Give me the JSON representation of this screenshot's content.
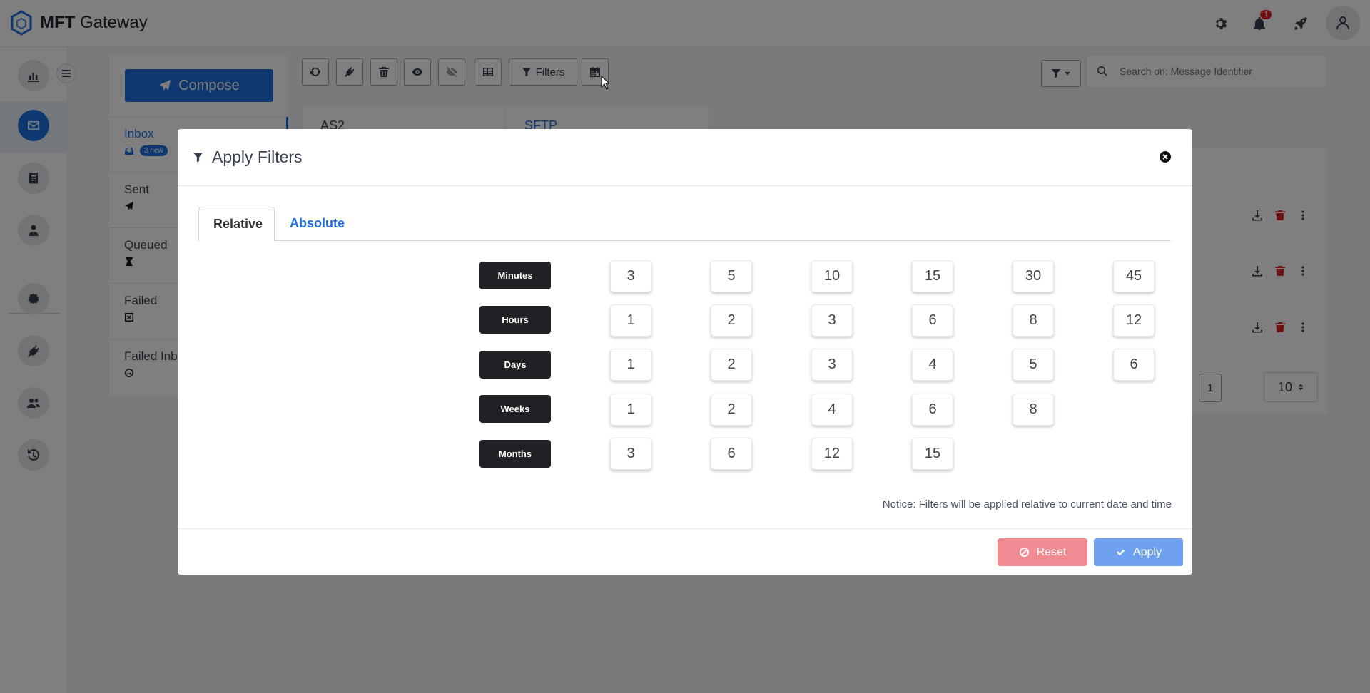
{
  "app": {
    "brand_bold": "MFT",
    "brand_rest": " Gateway",
    "notification_count": "1",
    "accent_color": "#1d6fe0"
  },
  "sidebar": {
    "items": [
      {
        "icon": "chart-icon"
      },
      {
        "icon": "envelope-icon",
        "active": true
      },
      {
        "icon": "receipt-icon"
      },
      {
        "icon": "user-tie-icon"
      },
      {
        "icon": "gear-burst-icon"
      },
      {
        "icon": "plug-icon"
      },
      {
        "icon": "users-icon"
      },
      {
        "icon": "history-icon"
      }
    ]
  },
  "folders": {
    "compose_label": "Compose",
    "items": [
      {
        "label": "Inbox",
        "badge": "3 new",
        "icon": "inbox-icon"
      },
      {
        "label": "Sent",
        "icon": "paper-plane-icon"
      },
      {
        "label": "Queued",
        "icon": "hourglass-icon"
      },
      {
        "label": "Failed",
        "icon": "x-square-icon"
      },
      {
        "label": "Failed Inb",
        "icon": "circle-arrow-icon"
      }
    ]
  },
  "toolbar": {
    "filters_label": "Filters",
    "search_placeholder": "Search on: Message Identifier"
  },
  "protocols": {
    "tabs": [
      "AS2",
      "SFTP"
    ]
  },
  "list": {
    "page": "1",
    "per_page": "10"
  },
  "modal": {
    "title": "Apply Filters",
    "tabs": {
      "relative": "Relative",
      "absolute": "Absolute"
    },
    "rows": [
      {
        "unit": "Minutes",
        "values": [
          "3",
          "5",
          "10",
          "15",
          "30",
          "45"
        ]
      },
      {
        "unit": "Hours",
        "values": [
          "1",
          "2",
          "3",
          "6",
          "8",
          "12"
        ]
      },
      {
        "unit": "Days",
        "values": [
          "1",
          "2",
          "3",
          "4",
          "5",
          "6"
        ]
      },
      {
        "unit": "Weeks",
        "values": [
          "1",
          "2",
          "4",
          "6",
          "8"
        ]
      },
      {
        "unit": "Months",
        "values": [
          "3",
          "6",
          "12",
          "15"
        ]
      }
    ],
    "notice": "Notice: Filters will be applied relative to current date and time",
    "reset_label": "Reset",
    "apply_label": "Apply",
    "reset_color": "#f28a92",
    "apply_color": "#6ea2ee"
  }
}
